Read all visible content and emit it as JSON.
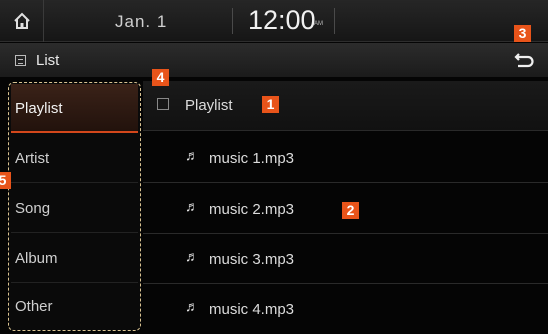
{
  "statusbar": {
    "home_icon": "home-icon",
    "date": "Jan.  1",
    "time": "12:00",
    "ampm": "AM"
  },
  "titlebar": {
    "title": "List",
    "title_icon": "list-icon",
    "back_icon": "back-arrow-icon"
  },
  "sidebar": {
    "items": [
      {
        "label": "Playlist",
        "active": true
      },
      {
        "label": "Artist",
        "active": false
      },
      {
        "label": "Song",
        "active": false
      },
      {
        "label": "Album",
        "active": false
      },
      {
        "label": "Other",
        "active": false
      }
    ]
  },
  "list": {
    "header": {
      "label": "Playlist",
      "icon": "folder-icon"
    },
    "items": [
      {
        "label": "music 1.mp3",
        "icon": "music-note-icon"
      },
      {
        "label": "music 2.mp3",
        "icon": "music-note-icon"
      },
      {
        "label": "music 3.mp3",
        "icon": "music-note-icon"
      },
      {
        "label": "music 4.mp3",
        "icon": "music-note-icon"
      }
    ]
  },
  "callouts": [
    "1",
    "2",
    "3",
    "4",
    "5"
  ],
  "colors": {
    "accent": "#e8541a",
    "active_underline": "#d4471b",
    "sidebar_outline": "#d9c392"
  }
}
